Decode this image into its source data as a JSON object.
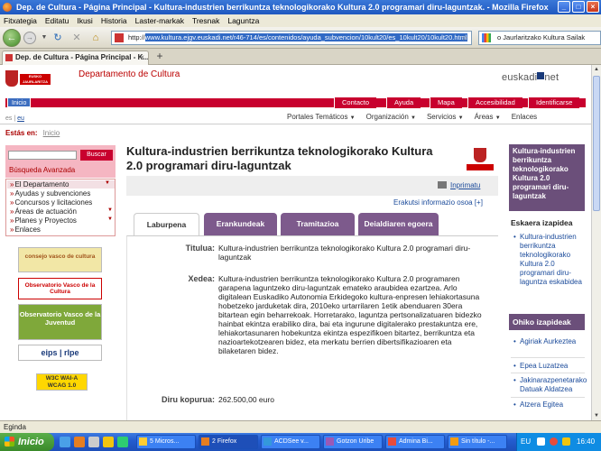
{
  "window": {
    "title": "Dep. de Cultura - Página Principal - Kultura-industrien berrikuntza teknologikorako Kultura 2.0 programari diru-laguntzak. - Mozilla Firefox",
    "controls": [
      "_",
      "□",
      "×"
    ]
  },
  "menubar": [
    "Fitxategia",
    "Editatu",
    "Ikusi",
    "Historia",
    "Laster-markak",
    "Tresnak",
    "Laguntza"
  ],
  "toolbar": {
    "url_prefix": "http://",
    "url_selected": "www.kultura.ejgv.euskadi.net/r46-714/es/contenidos/ayuda_subvencion/10kult20/es_10kult20/10kult20.html",
    "search_text": "o Jaurlaritzako Kultura Sailak"
  },
  "browser_tab": {
    "title": "Dep. de Cultura - Página Principal - K...",
    "close": "×",
    "new": "+"
  },
  "header": {
    "logo_text": "EUSKO JAURLARITZA GOBIERNO VASCO",
    "dept": "Departamento de Cultura",
    "brand": "euskadi",
    "brand_suffix": "net",
    "home": "Inicio",
    "links": [
      "Contacto",
      "Ayuda",
      "Mapa",
      "Accesibilidad",
      "Identificarse"
    ]
  },
  "lang": {
    "es": "es",
    "sep": "|",
    "eu": "eu"
  },
  "topnav": [
    "Portales Temáticos",
    "Organización",
    "Servicios",
    "Áreas",
    "Enlaces"
  ],
  "breadcrumb": {
    "label": "Estás en:",
    "link": "Inicio"
  },
  "sidebar": {
    "search_button": "Buscar",
    "advanced": "Búsqueda Avanzada",
    "menu": [
      {
        "label": "El Departamento",
        "dropdown": true
      },
      {
        "label": "Ayudas y subvenciones",
        "dropdown": false
      },
      {
        "label": "Concursos y licitaciones",
        "dropdown": false
      },
      {
        "label": "Áreas de actuación",
        "dropdown": true
      },
      {
        "label": "Planes y Proyectos",
        "dropdown": true
      },
      {
        "label": "Enlaces",
        "dropdown": false
      }
    ],
    "banners": [
      "consejo vasco de cultura",
      "Observatorio Vasco de la Cultura",
      "Observatorio Vasco de la Juventud",
      "eips | rlpe",
      "W3C WAI-A WCAG 1.0"
    ]
  },
  "main": {
    "title": "Kultura-industrien berrikuntza teknologikorako Kultura 2.0 programari diru-laguntzak",
    "print": "Inprimatu",
    "more_info": "Erakutsi informazio osoa [+]",
    "tabs": [
      "Laburpena",
      "Erankundeak",
      "Tramitazioa",
      "Deialdiaren egoera"
    ],
    "fields": [
      {
        "label": "Titulua:",
        "value": "Kultura-industrien berrikuntza teknologikorako Kultura 2.0 programari diru-laguntzak"
      },
      {
        "label": "Xedea:",
        "value": "Kultura-industrien berrikuntza teknologikorako Kultura 2.0 programaren garapena laguntzeko diru-laguntzak emateko araubidea ezartzea. Arlo digitalean Euskadiko Autonomia Erkidegoko kultura-enpresen lehiakortasuna hobetzeko jarduketak dira, 2010eko urtarrilaren 1etik abenduaren 30era bitartean egin beharrekoak. Horretarako, laguntza pertsonalizatuaren bidezko hainbat ekintza erabiliko dira, bai eta ingurune digitalerako prestakuntza ere, lehiakortasunaren hobekuntza ekintza espezifikoen bitartez, berrikuntza eta nazioartekotzearen bidez, eta merkatu berrien dibertsifikazioaren eta bilaketaren bidez."
      },
      {
        "label": "Diru kopurua:",
        "value": "262.500,00 euro"
      }
    ]
  },
  "rightcol": {
    "box_title": "Kultura-industrien berrikuntza teknologikorako Kultura 2.0 programari diru-laguntzak",
    "h1": "Eskaera izapidea",
    "link1": "Kultura-industrien berrikuntza teknologikorako Kultura 2.0 programari diru-laguntza eskabidea",
    "h2": "Ohiko izapideak",
    "links2": [
      "Agiriak Aurkeztea",
      "Epea Luzatzea",
      "Jakinarazpenetarako Datuak Aldatzea",
      "Atzera Egitea"
    ]
  },
  "status": {
    "text": "Egindа"
  },
  "taskbar": {
    "start": "Inicio",
    "items": [
      "5 Micros...",
      "2 Firefox",
      "ACDSee v...",
      "Gotzon Uribe",
      "Admina Bi...",
      "Sin título -..."
    ],
    "lang": "EU",
    "clock": "16:40"
  }
}
